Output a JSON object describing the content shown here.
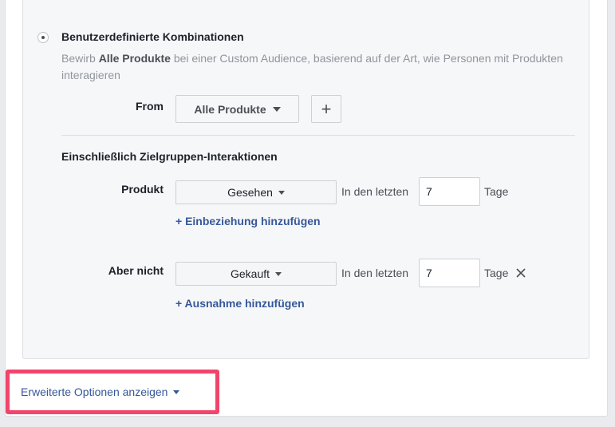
{
  "option": {
    "title": "Benutzerdefinierte Kombinationen",
    "desc_prefix": "Bewirb ",
    "desc_bold": "Alle Produkte",
    "desc_suffix": " bei einer Custom Audience, basierend auf der Art, wie Personen mit Produkten interagieren",
    "selected": true
  },
  "from": {
    "label": "From",
    "dropdown_value": "Alle Produkte",
    "add_button": "+"
  },
  "interactions": {
    "title": "Einschließlich Zielgruppen-Interaktionen",
    "include_rule": {
      "label": "Produkt",
      "event": "Gesehen",
      "within_text": "In den letzten",
      "days_value": "7",
      "days_unit": "Tage",
      "add_link": "+ Einbeziehung hinzufügen"
    },
    "exclude_rule": {
      "label": "Aber nicht",
      "event": "Gekauft",
      "within_text": "In den letzten",
      "days_value": "7",
      "days_unit": "Tage",
      "add_link": "+ Ausnahme hinzufügen"
    }
  },
  "advanced": {
    "link_label": "Erweiterte Optionen anzeigen"
  },
  "icons": {
    "radio": "radio-selected-icon",
    "remove": "close-icon",
    "dropdown": "caret-down-icon"
  },
  "colors": {
    "link": "#365899",
    "highlight": "#f2456b"
  }
}
